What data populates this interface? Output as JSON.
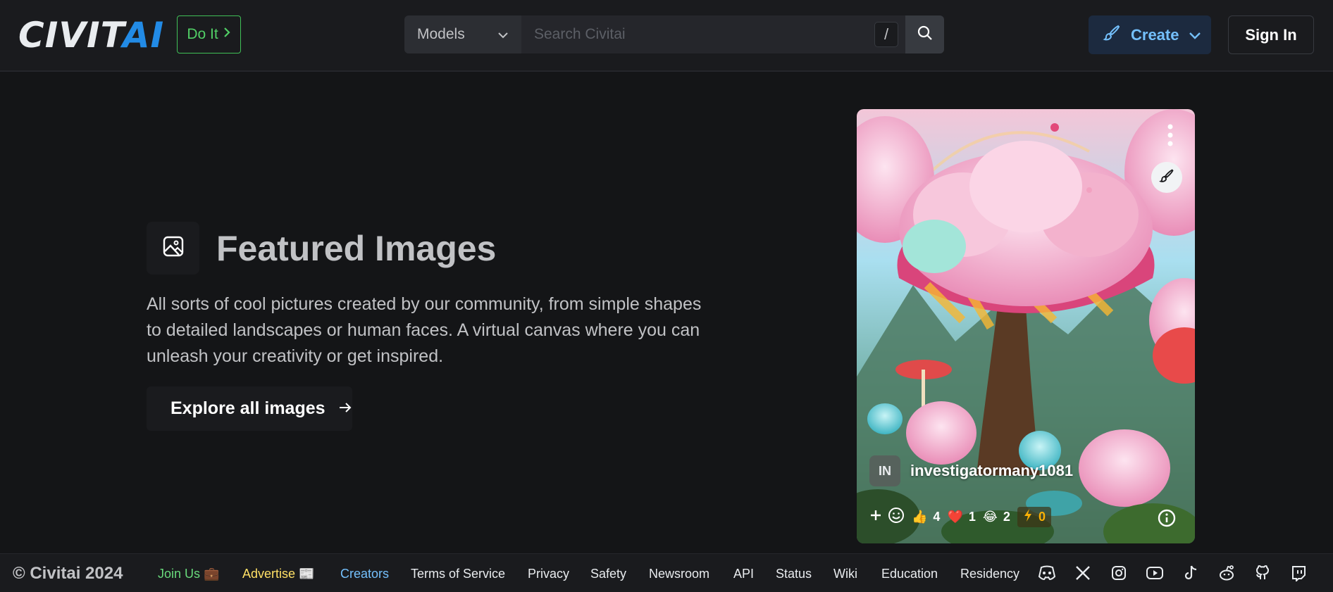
{
  "header": {
    "logo_left": "CIVIT",
    "logo_right": "AI",
    "doit_label": "Do It",
    "search_scope": "Models",
    "search_placeholder": "Search Civitai",
    "search_shortcut": "/",
    "create_label": "Create",
    "signin_label": "Sign In"
  },
  "featured": {
    "title": "Featured Images",
    "description": "All sorts of cool pictures created by our community, from simple shapes to detailed landscapes or human faces. A virtual canvas where you can unleash your creativity or get inspired.",
    "explore_label": "Explore all images"
  },
  "card": {
    "avatar_initials": "IN",
    "username": "investigatormany1081",
    "reactions": {
      "like": "4",
      "heart": "1",
      "laugh": "2",
      "buzz": "0"
    },
    "icons": [
      "more-vertical-icon",
      "brush-icon",
      "add-reaction-icon",
      "info-icon"
    ]
  },
  "footer": {
    "copyright": "© Civitai 2024",
    "links": {
      "join": "Join Us 💼",
      "advertise": "Advertise 📰",
      "creators": "Creators",
      "terms": "Terms of Service",
      "privacy": "Privacy",
      "safety": "Safety",
      "newsroom": "Newsroom",
      "api": "API",
      "status": "Status",
      "wiki": "Wiki",
      "education": "Education",
      "residency": "Residency"
    },
    "link_colors": {
      "join": "#69db7c",
      "advertise": "#ffe066",
      "creators": "#74c0fc"
    },
    "social_icons": [
      "discord-icon",
      "x-icon",
      "instagram-icon",
      "youtube-icon",
      "tiktok-icon",
      "reddit-icon",
      "github-icon",
      "twitch-icon"
    ]
  },
  "colors": {
    "background": "#141517",
    "header": "#1a1b1e",
    "accent_blue": "#228be6",
    "accent_green": "#40c057"
  }
}
